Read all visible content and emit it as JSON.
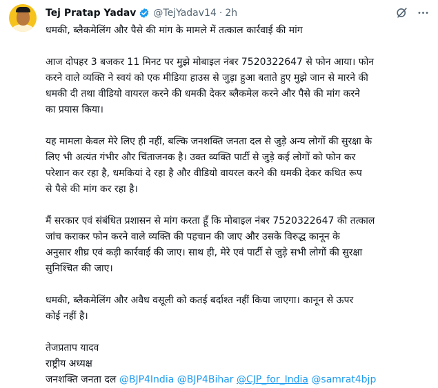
{
  "author": {
    "name": "Tej Pratap Yadav",
    "handle": "@TejYadav14",
    "separator": "·",
    "time": "2h"
  },
  "icons": {
    "verified": "verified-badge-icon",
    "grok": "grok-slash-icon",
    "more": "more-dots-icon"
  },
  "colors": {
    "accent": "#1d9bf0",
    "text": "#0f1419",
    "muted": "#536471"
  },
  "tweet": {
    "headline": "धमकी, ब्लैकमेलिंग और पैसे की मांग के मामले में तत्काल कार्रवाई की मांग",
    "p1": [
      "आज दोपहर 3 बजकर 11 मिनट पर मुझे मोबाइल नंबर 7520322647 से फोन आया। फोन",
      "करने वाले व्यक्ति ने स्वयं को एक मीडिया हाउस से जुड़ा हुआ बताते हुए मुझे जान से मारने की",
      "धमकी दी तथा वीडियो वायरल करने की धमकी देकर ब्लैकमेल करने और पैसे की मांग करने",
      "का प्रयास किया।"
    ],
    "p2": [
      "यह मामला केवल मेरे लिए ही नहीं, बल्कि जनशक्ति जनता दल से जुड़े अन्य लोगों की सुरक्षा के",
      "लिए भी अत्यंत गंभीर और चिंताजनक है। उक्त व्यक्ति पार्टी से जुड़े कई लोगों को फोन कर",
      "परेशान कर रहा है, धमकियां दे रहा है और वीडियो वायरल करने की धमकी देकर कथित रूप",
      "से पैसे की मांग कर रहा है।"
    ],
    "p3": [
      "मैं सरकार एवं संबंधित प्रशासन से मांग करता हूँ कि मोबाइल नंबर 7520322647 की तत्काल",
      "जांच कराकर फोन करने वाले व्यक्ति की पहचान की जाए और उसके विरुद्ध कानून के",
      "अनुसार शीघ्र एवं कड़ी कार्रवाई की जाए। साथ ही, मेरे एवं पार्टी से जुड़े सभी लोगों की सुरक्षा",
      "सुनिश्चित की जाए।"
    ],
    "p4": [
      "धमकी, ब्लैकमेलिंग और अवैध वसूली को कतई बर्दाश्त नहीं किया जाएगा। कानून से ऊपर",
      "कोई नहीं है।"
    ],
    "signature": {
      "name": "तेजप्रताप यादव",
      "title": "राष्ट्रीय अध्यक्ष",
      "party": "जनशक्ति जनता दल"
    },
    "mentions": [
      "@BJP4India",
      "@BJP4Bihar",
      "@CJP_for_India",
      "@samrat4bjp"
    ]
  }
}
